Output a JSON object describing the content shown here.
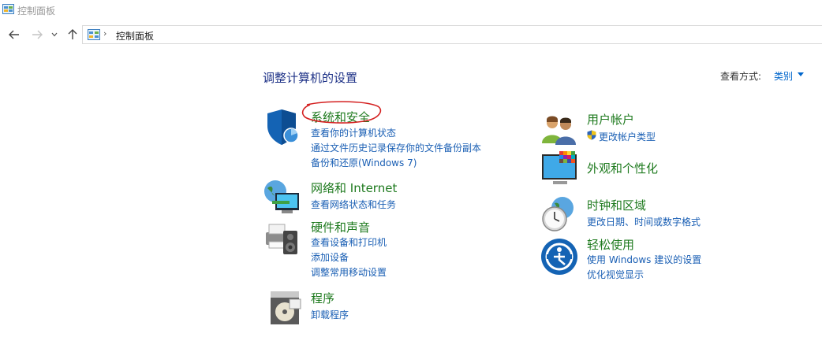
{
  "window": {
    "title": "控制面板"
  },
  "nav": {
    "back": "back-arrow-icon",
    "forward": "forward-arrow-icon",
    "recent": "chevron-down-icon",
    "up": "up-arrow-icon"
  },
  "address": {
    "separator": "›",
    "path": "控制面板"
  },
  "main": {
    "heading": "调整计算机的设置",
    "view_by_label": "查看方式:",
    "view_by_value": "类别"
  },
  "categories_left": [
    {
      "title": "系统和安全",
      "icon": "shield-icon",
      "links": [
        "查看你的计算机状态",
        "通过文件历史记录保存你的文件备份副本",
        "备份和还原(Windows 7)"
      ]
    },
    {
      "title": "网络和 Internet",
      "icon": "network-globe-icon",
      "links": [
        "查看网络状态和任务"
      ]
    },
    {
      "title": "硬件和声音",
      "icon": "printer-speaker-icon",
      "links": [
        "查看设备和打印机",
        "添加设备",
        "调整常用移动设置"
      ]
    },
    {
      "title": "程序",
      "icon": "programs-disc-icon",
      "links": [
        "卸载程序"
      ]
    }
  ],
  "categories_right": [
    {
      "title": "用户帐户",
      "icon": "users-icon",
      "links": [
        "更改帐户类型"
      ]
    },
    {
      "title": "外观和个性化",
      "icon": "monitor-palette-icon",
      "links": []
    },
    {
      "title": "时钟和区域",
      "icon": "clock-globe-icon",
      "links": [
        "更改日期、时间或数字格式"
      ]
    },
    {
      "title": "轻松使用",
      "icon": "ease-of-access-icon",
      "links": [
        "使用 Windows 建议的设置",
        "优化视觉显示"
      ]
    }
  ],
  "colors": {
    "heading": "#1e3287",
    "category": "#1e7a1e",
    "link": "#1a5fb4",
    "annotation": "#d42020"
  }
}
